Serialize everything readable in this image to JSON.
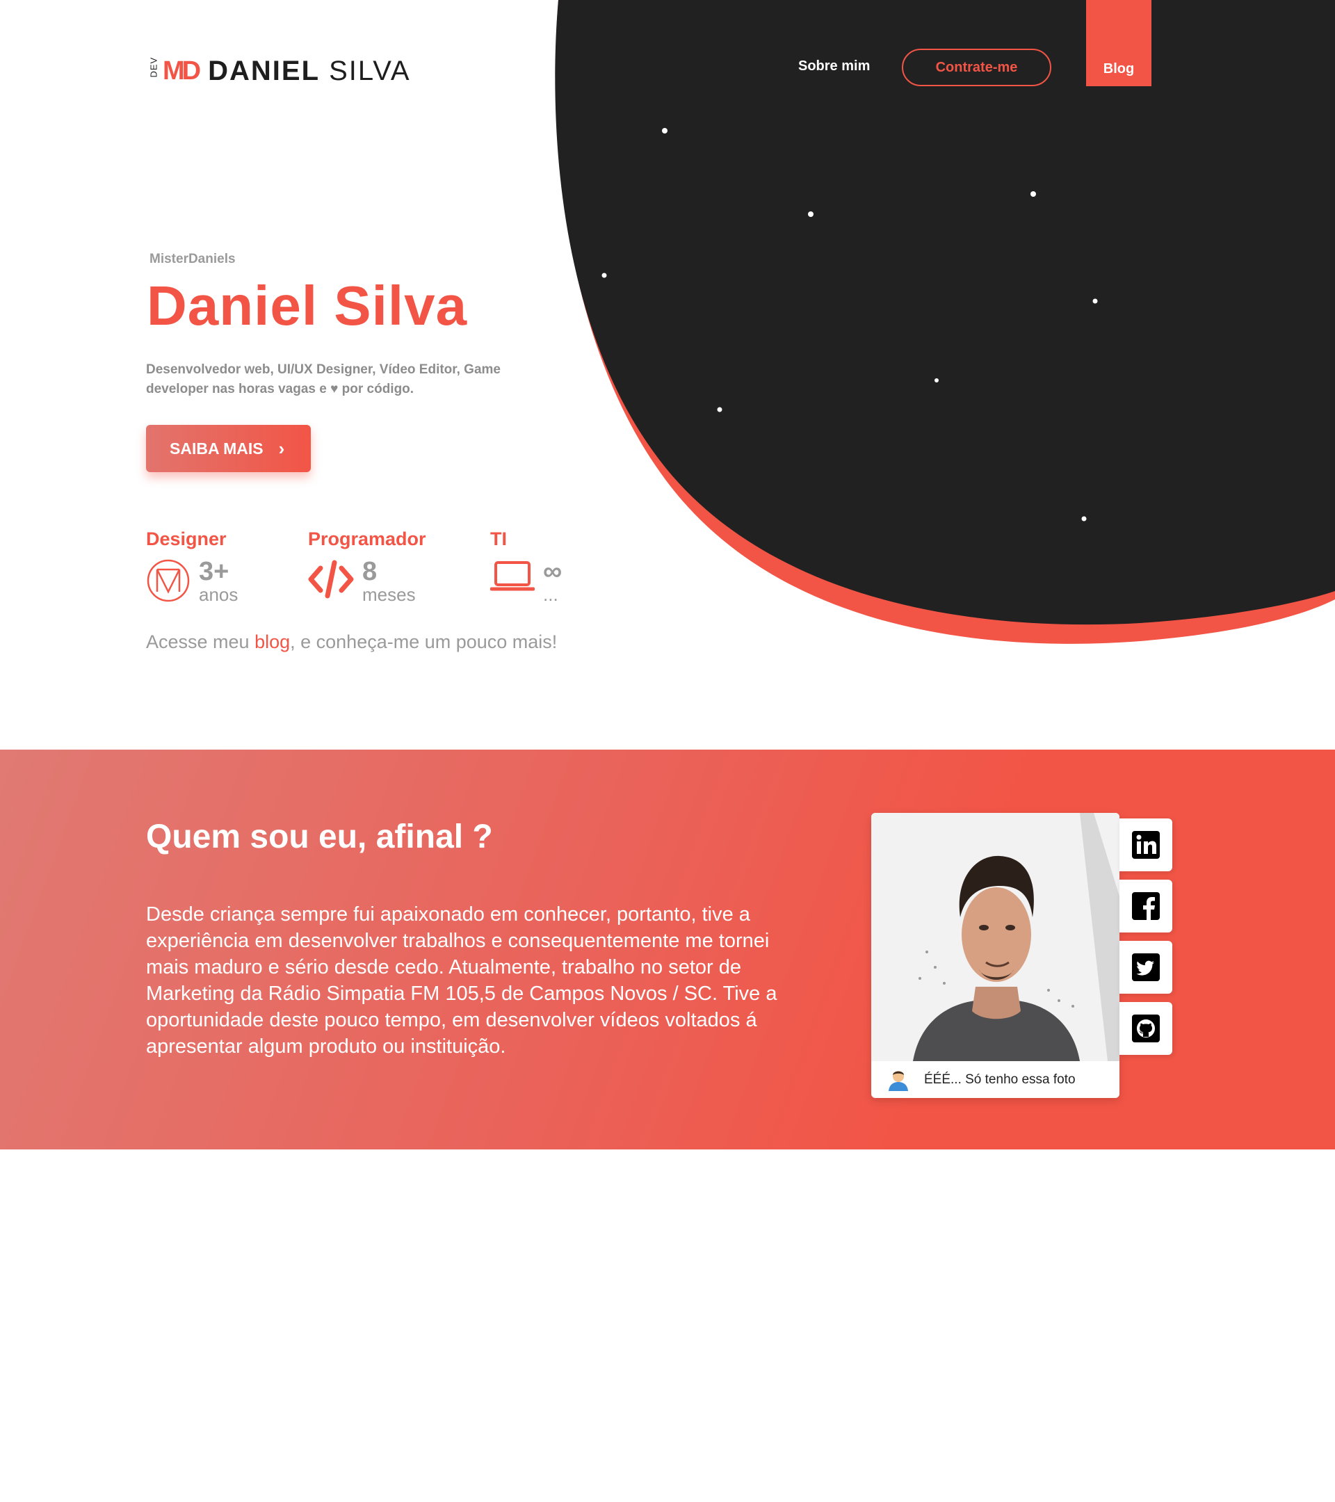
{
  "brand": {
    "prefix": "DEV",
    "monogram": "MD",
    "first_name": "DANIEL",
    "last_name": "SILVA"
  },
  "nav": {
    "about": "Sobre mim",
    "hire": "Contrate-me",
    "blog": "Blog"
  },
  "hero": {
    "handle": "MisterDaniels",
    "title": "Daniel Silva",
    "description": "Desenvolvedor web, UI/UX Designer, Vídeo Editor, Game developer nas horas vagas e ♥ por código.",
    "cta": "SAIBA MAIS"
  },
  "stats": [
    {
      "label": "Designer",
      "value": "3+",
      "unit": "anos",
      "icon": "logo-m-icon"
    },
    {
      "label": "Programador",
      "value": "8",
      "unit": "meses",
      "icon": "code-icon"
    },
    {
      "label": "TI",
      "value": "∞",
      "unit": "...",
      "icon": "laptop-icon"
    }
  ],
  "blog_line": {
    "before": "Acesse meu ",
    "link": "blog",
    "after": ", e conheça-me um pouco mais!"
  },
  "about": {
    "title": "Quem sou eu, afinal ?",
    "text": "Desde criança sempre fui apaixonado em conhecer, portanto, tive a experiência em desenvolver trabalhos e consequentemente me tornei mais maduro e sério desde cedo. Atualmente, trabalho no setor de Marketing da Rádio Simpatia FM 105,5 de Campos Novos / SC. Tive a oportunidade deste pouco tempo, em desenvolver vídeos voltados á apresentar algum produto ou instituição.",
    "photo_caption": "ÉÉÉ... Só tenho essa foto"
  },
  "social": [
    "linkedin-icon",
    "facebook-icon",
    "twitter-icon",
    "github-icon"
  ],
  "colors": {
    "accent": "#f25546",
    "dark": "#222222",
    "muted": "#9a9a9a"
  }
}
